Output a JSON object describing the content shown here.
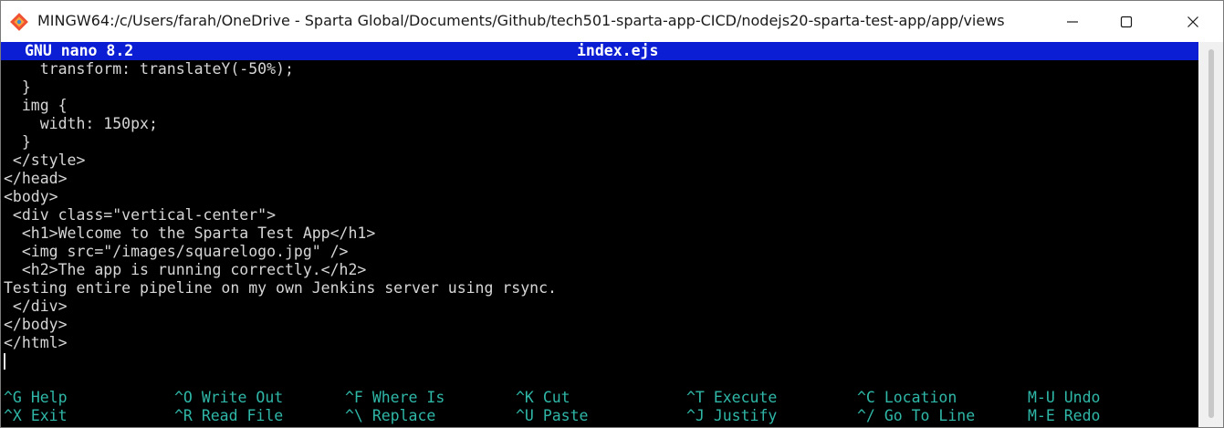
{
  "window": {
    "title": "MINGW64:/c/Users/farah/OneDrive - Sparta Global/Documents/Github/tech501-sparta-app-CICD/nodejs20-sparta-test-app/app/views",
    "icon": "git-bash-icon"
  },
  "nano": {
    "version": "GNU nano 8.2",
    "filename": "index.ejs"
  },
  "editor": {
    "lines": [
      "    transform: translateY(-50%);",
      "  }",
      "  img {",
      "    width: 150px;",
      "  }",
      " </style>",
      "</head>",
      "<body>",
      " <div class=\"vertical-center\">",
      "  <h1>Welcome to the Sparta Test App</h1>",
      "  <img src=\"/images/squarelogo.jpg\" />",
      "  <h2>The app is running correctly.</h2>",
      "Testing entire pipeline on my own Jenkins server using rsync.",
      " </div>",
      "</body>",
      "</html>"
    ]
  },
  "shortcuts": {
    "row1": [
      {
        "key": "^G",
        "label": "Help"
      },
      {
        "key": "^O",
        "label": "Write Out"
      },
      {
        "key": "^F",
        "label": "Where Is"
      },
      {
        "key": "^K",
        "label": "Cut"
      },
      {
        "key": "^T",
        "label": "Execute"
      },
      {
        "key": "^C",
        "label": "Location"
      },
      {
        "key": "M-U",
        "label": "Undo"
      }
    ],
    "row2": [
      {
        "key": "^X",
        "label": "Exit"
      },
      {
        "key": "^R",
        "label": "Read File"
      },
      {
        "key": "^\\",
        "label": "Replace"
      },
      {
        "key": "^U",
        "label": "Paste"
      },
      {
        "key": "^J",
        "label": "Justify"
      },
      {
        "key": "^/",
        "label": "Go To Line"
      },
      {
        "key": "M-E",
        "label": "Redo"
      }
    ]
  },
  "colors": {
    "header_bg": "#0c1ed4",
    "shortcut_text": "#2fb7a7",
    "terminal_bg": "#000000",
    "terminal_text": "#d6d6d6"
  }
}
